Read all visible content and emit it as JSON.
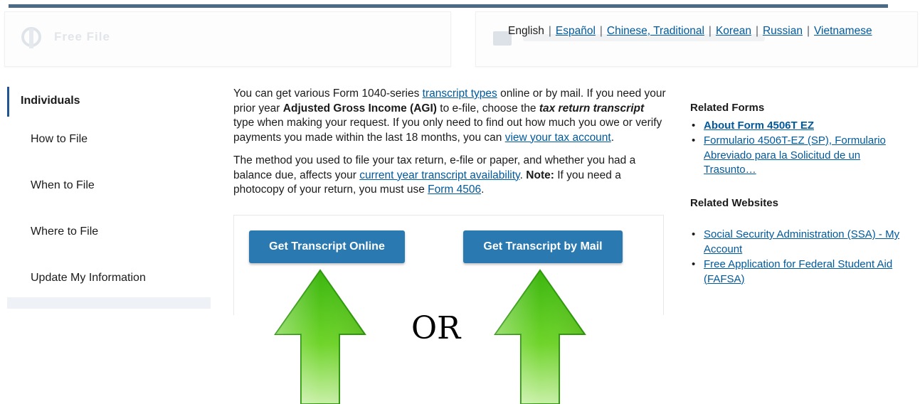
{
  "header": {
    "faded_logo_text": "Free File",
    "languages": [
      {
        "label": "English",
        "current": true
      },
      {
        "label": "Español",
        "current": false
      },
      {
        "label": "Chinese, Traditional",
        "current": false
      },
      {
        "label": "Korean",
        "current": false
      },
      {
        "label": "Russian",
        "current": false
      },
      {
        "label": "Vietnamese",
        "current": false
      }
    ],
    "separator": "|"
  },
  "sidebar": {
    "title": "Individuals",
    "items": [
      {
        "label": "How to File"
      },
      {
        "label": "When to File"
      },
      {
        "label": "Where to File"
      },
      {
        "label": "Update My Information"
      }
    ]
  },
  "main": {
    "p1": {
      "t1": "You can get various Form 1040-series ",
      "link1": "transcript types",
      "t2": " online or by mail. If you need your prior year ",
      "b1": "Adjusted Gross Income (AGI)",
      "t3": " to e-file, choose the ",
      "bi1": "tax return transcript",
      "t4": " type when making your request. If you only need to find out how much you owe or verify payments you made within the last 18 months, you can ",
      "link2": "view your tax account",
      "t5": "."
    },
    "p2": {
      "t1": "The method you used to file your tax return, e-file or paper, and whether you had a balance due, affects your ",
      "link1": "current year transcript availability",
      "t2": ". ",
      "b1": "Note:",
      "t3": " If you need a photocopy of your return, you must use ",
      "link2": "Form 4506",
      "t4": "."
    },
    "buttons": {
      "online": "Get Transcript Online",
      "mail": "Get Transcript by Mail"
    },
    "or_label": "OR"
  },
  "right": {
    "related_forms": {
      "heading": "Related Forms",
      "links": [
        "About Form 4506T EZ",
        "Formulario 4506T-EZ (SP), Formulario Abreviado para la Solicitud de un Trasunto…"
      ]
    },
    "related_websites": {
      "heading": "Related Websites",
      "links": [
        "Social Security Administration (SSA) - My Account",
        "Free Application for Federal Student Aid (FAFSA)"
      ]
    }
  },
  "colors": {
    "button_bg": "#2a79b0",
    "link": "#00599c",
    "arrow_green": "#52c41a"
  }
}
